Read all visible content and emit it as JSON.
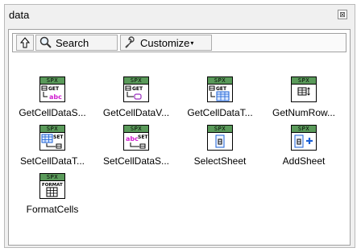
{
  "window": {
    "title": "data",
    "close_glyph": "⊠"
  },
  "toolbar": {
    "up_icon": "up-arrow-icon",
    "search_label": "Search",
    "customize_label": "Customize",
    "customize_caret": "▾"
  },
  "icon_banner": "SPX",
  "items": [
    {
      "label": "GetCellDataS...",
      "icon": "get-cell-data-string-icon"
    },
    {
      "label": "GetCellDataV...",
      "icon": "get-cell-data-variant-icon"
    },
    {
      "label": "GetCellDataT...",
      "icon": "get-cell-data-table-icon"
    },
    {
      "label": "GetNumRow...",
      "icon": "get-num-rows-icon"
    },
    {
      "label": "SetCellDataT...",
      "icon": "set-cell-data-table-icon"
    },
    {
      "label": "SetCellDataS...",
      "icon": "set-cell-data-string-icon"
    },
    {
      "label": "SelectSheet",
      "icon": "select-sheet-icon"
    },
    {
      "label": "AddSheet",
      "icon": "add-sheet-icon"
    },
    {
      "label": "FormatCells",
      "icon": "format-cells-icon"
    }
  ],
  "colors": {
    "banner": "#5a9a5a",
    "accent_blue": "#1a5fd6",
    "accent_magenta": "#d020d0"
  }
}
